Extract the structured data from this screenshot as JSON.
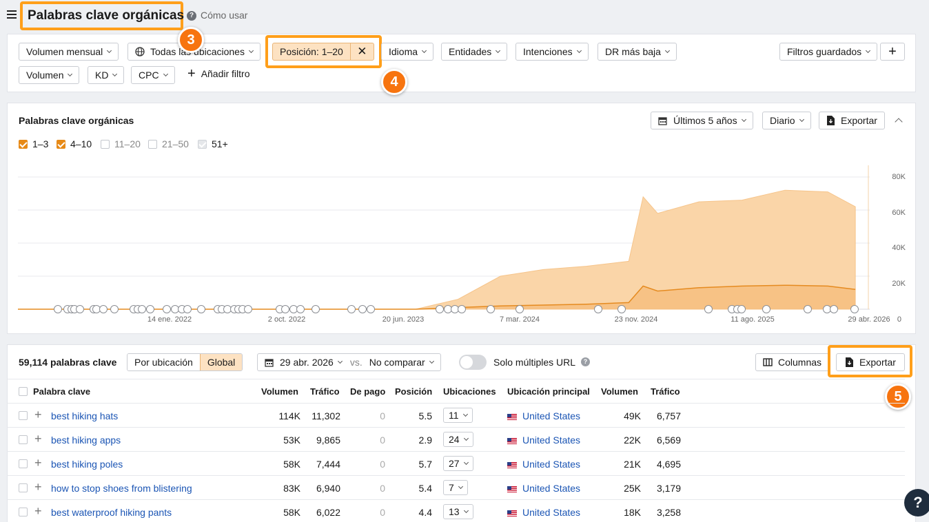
{
  "header": {
    "title": "Palabras clave orgánicas",
    "how_to": "Cómo usar"
  },
  "filters": {
    "volumen_mensual": "Volumen mensual",
    "ubicaciones": "Todas las ubicaciones",
    "posicion": "Posición: 1–20",
    "idioma": "Idioma",
    "entidades": "Entidades",
    "intenciones": "Intenciones",
    "dr": "DR más baja",
    "filtros_guardados": "Filtros guardados",
    "volumen": "Volumen",
    "kd": "KD",
    "cpc": "CPC",
    "anadir": "Añadir filtro"
  },
  "badges": {
    "b3": "3",
    "b4": "4",
    "b5": "5",
    "help": "?"
  },
  "chart": {
    "title": "Palabras clave orgánicas",
    "period": "Últimos 5 años",
    "granularity": "Diario",
    "export": "Exportar",
    "legend": [
      {
        "label": "1–3",
        "state": "on"
      },
      {
        "label": "4–10",
        "state": "on"
      },
      {
        "label": "11–20",
        "state": "off"
      },
      {
        "label": "21–50",
        "state": "off"
      },
      {
        "label": "51+",
        "state": "disabled"
      }
    ],
    "y_ticks": [
      "80K",
      "60K",
      "40K",
      "20K",
      "0"
    ],
    "x_ticks": [
      "14 ene. 2022",
      "2 oct. 2022",
      "20 jun. 2023",
      "7 mar. 2024",
      "23 nov. 2024",
      "11 ago. 2025",
      "29 abr. 2026"
    ],
    "colors": {
      "area_4_10": "#fad5a8",
      "area_1_3": "#f5bb7a",
      "line_1_3": "#e58a1f"
    }
  },
  "chart_data": {
    "type": "area",
    "x": [
      "2021-05",
      "2021-11",
      "2022-05",
      "2022-11",
      "2023-05",
      "2023-09",
      "2023-12",
      "2024-03",
      "2024-06",
      "2024-09",
      "2024-12",
      "2025-01",
      "2025-02",
      "2025-05",
      "2025-08",
      "2025-11",
      "2026-02",
      "2026-04"
    ],
    "series": [
      {
        "name": "1–3",
        "values": [
          0,
          0,
          0,
          0,
          0,
          0,
          1000,
          2000,
          2500,
          3000,
          4000,
          14000,
          11000,
          13000,
          14000,
          14500,
          14000,
          12000
        ]
      },
      {
        "name": "4–10",
        "values": [
          0,
          0,
          0,
          0,
          0,
          0,
          6000,
          20000,
          24000,
          26000,
          29000,
          68000,
          58000,
          65000,
          66000,
          72000,
          71000,
          62000
        ]
      }
    ],
    "ylim": [
      0,
      80000
    ],
    "grid": true
  },
  "table_toolbar": {
    "count": "59,114 palabras clave",
    "por_ubicacion": "Por ubicación",
    "global": "Global",
    "date": "29 abr. 2026",
    "vs": "vs.",
    "compare": "No comparar",
    "multiple_url": "Solo múltiples URL",
    "columnas": "Columnas",
    "exportar": "Exportar"
  },
  "table": {
    "headers": [
      "Palabra clave",
      "Volumen",
      "Tráfico",
      "De pago",
      "Posición",
      "Ubicaciones",
      "Ubicación principal",
      "Volumen",
      "Tráfico"
    ],
    "rows": [
      {
        "keyword": "best hiking hats",
        "volume": "114K",
        "traffic": "11,302",
        "paid": "0",
        "position": "5.5",
        "locations": "11",
        "main": "United States",
        "main_volume": "49K",
        "main_traffic": "6,757"
      },
      {
        "keyword": "best hiking apps",
        "volume": "53K",
        "traffic": "9,865",
        "paid": "0",
        "position": "2.9",
        "locations": "24",
        "main": "United States",
        "main_volume": "22K",
        "main_traffic": "6,569"
      },
      {
        "keyword": "best hiking poles",
        "volume": "58K",
        "traffic": "7,444",
        "paid": "0",
        "position": "5.7",
        "locations": "27",
        "main": "United States",
        "main_volume": "21K",
        "main_traffic": "4,695"
      },
      {
        "keyword": "how to stop shoes from blistering",
        "volume": "83K",
        "traffic": "6,940",
        "paid": "0",
        "position": "5.4",
        "locations": "7",
        "main": "United States",
        "main_volume": "25K",
        "main_traffic": "3,179"
      },
      {
        "keyword": "best waterproof hiking pants",
        "volume": "58K",
        "traffic": "6,022",
        "paid": "0",
        "position": "4.4",
        "locations": "13",
        "main": "United States",
        "main_volume": "18K",
        "main_traffic": "3,258"
      }
    ]
  }
}
